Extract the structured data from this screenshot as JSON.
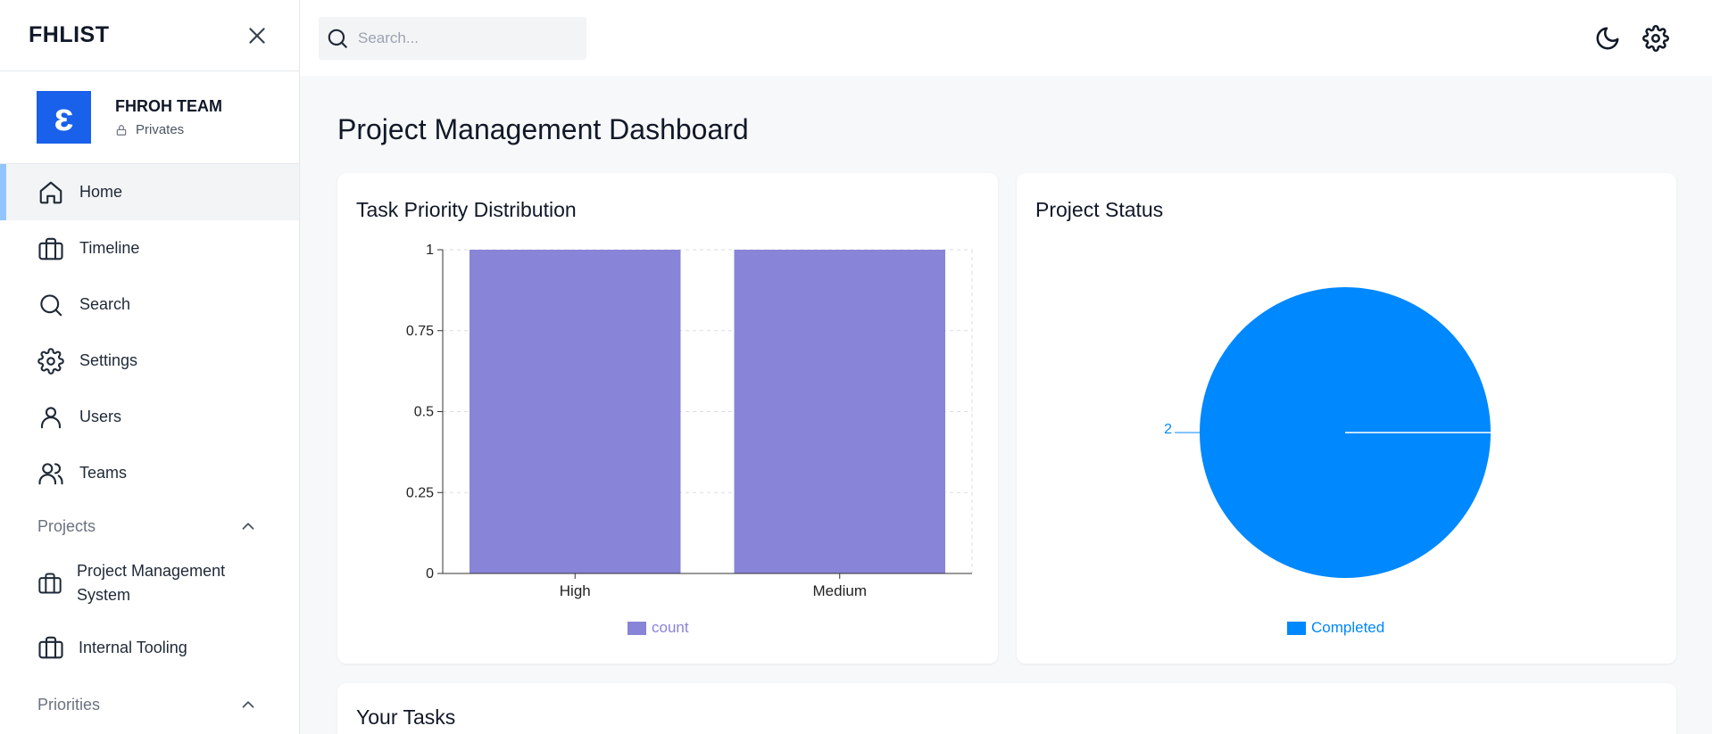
{
  "sidebar": {
    "brand": "FHLIST",
    "team": {
      "logo_letter": "ɛ",
      "name": "FHROH TEAM",
      "visibility": "Privates"
    },
    "nav": [
      {
        "label": "Home",
        "icon": "home-icon",
        "active": true
      },
      {
        "label": "Timeline",
        "icon": "briefcase-icon"
      },
      {
        "label": "Search",
        "icon": "search-icon"
      },
      {
        "label": "Settings",
        "icon": "gear-icon"
      },
      {
        "label": "Users",
        "icon": "user-icon"
      },
      {
        "label": "Teams",
        "icon": "users-icon"
      }
    ],
    "projects_section": {
      "label": "Projects",
      "items": [
        {
          "label": "Project Management System",
          "icon": "briefcase-icon"
        },
        {
          "label": "Internal Tooling",
          "icon": "briefcase-icon"
        }
      ]
    },
    "priorities_section": {
      "label": "Priorities"
    }
  },
  "topbar": {
    "search_placeholder": "Search..."
  },
  "main": {
    "title": "Project Management Dashboard",
    "card_priority_title": "Task Priority Distribution",
    "card_status_title": "Project Status",
    "card_tasks_title": "Your Tasks"
  },
  "colors": {
    "accent": "#1960ea",
    "bar": "#8884d8",
    "pie": "#0088fe"
  },
  "chart_data": [
    {
      "type": "bar",
      "title": "Task Priority Distribution",
      "categories": [
        "High",
        "Medium"
      ],
      "series": [
        {
          "name": "count",
          "values": [
            1,
            1
          ]
        }
      ],
      "ylim": [
        0,
        1
      ],
      "yticks": [
        "0",
        "0.25",
        "0.5",
        "0.75",
        "1"
      ],
      "grid": true,
      "legend": "bottom"
    },
    {
      "type": "pie",
      "title": "Project Status",
      "slices": [
        {
          "name": "Completed",
          "value": 2
        }
      ],
      "labels": [
        "2"
      ],
      "legend": "bottom"
    }
  ]
}
